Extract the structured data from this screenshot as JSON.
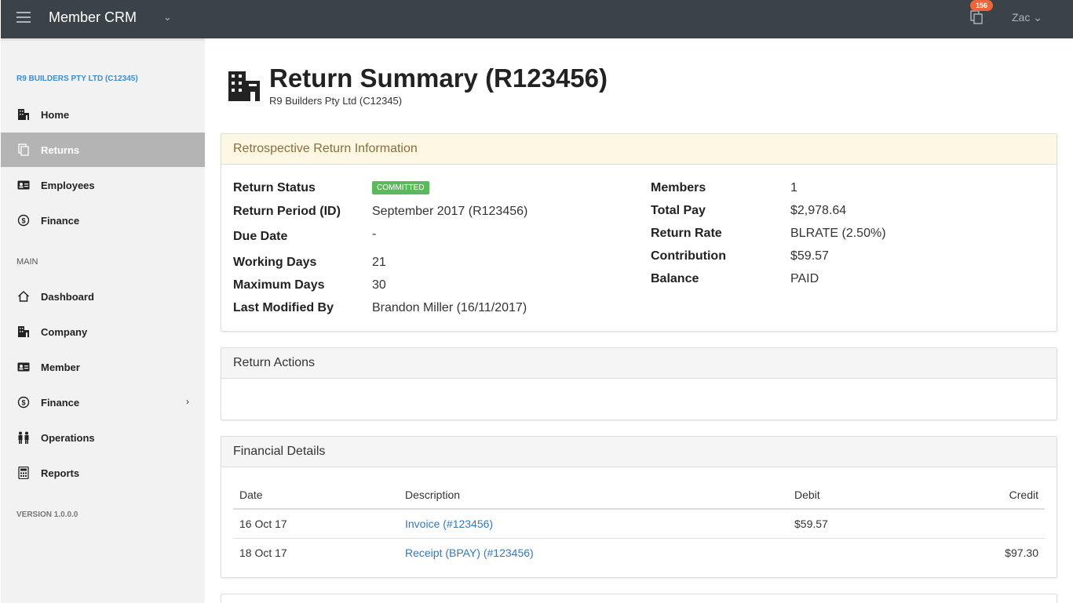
{
  "topbar": {
    "app_title": "Member CRM",
    "notification_count": "156",
    "user_name": "Zac"
  },
  "sidebar": {
    "company": "R9 BUILDERS PTY LTD (C12345)",
    "items": [
      {
        "label": "Home",
        "icon": "building-icon"
      },
      {
        "label": "Returns",
        "icon": "copy-icon",
        "active": true
      },
      {
        "label": "Employees",
        "icon": "id-card-icon"
      },
      {
        "label": "Finance",
        "icon": "dollar-circle-icon"
      }
    ],
    "main_section": "MAIN",
    "main_items": [
      {
        "label": "Dashboard",
        "icon": "home-icon"
      },
      {
        "label": "Company",
        "icon": "building-icon"
      },
      {
        "label": "Member",
        "icon": "id-card-icon"
      },
      {
        "label": "Finance",
        "icon": "dollar-circle-icon",
        "has_submenu": true
      },
      {
        "label": "Operations",
        "icon": "people-icon"
      },
      {
        "label": "Reports",
        "icon": "calculator-icon"
      }
    ],
    "version": "VERSION 1.0.0.0"
  },
  "page": {
    "title": "Return Summary (R123456)",
    "subtitle": "R9 Builders Pty Ltd (C12345)"
  },
  "info_panel": {
    "heading": "Retrospective Return Information",
    "left": [
      {
        "label": "Return Status",
        "value": "COMMITTED",
        "badge": true
      },
      {
        "label": "Return Period (ID)",
        "value": "September 2017 (R123456)"
      },
      {
        "label": "Due Date",
        "value": "-"
      },
      {
        "label": "Working Days",
        "value": "21"
      },
      {
        "label": "Maximum Days",
        "value": "30"
      },
      {
        "label": "Last Modified By",
        "value": "Brandon Miller (16/11/2017)"
      }
    ],
    "right": [
      {
        "label": "Members",
        "value": "1"
      },
      {
        "label": "Total Pay",
        "value": "$2,978.64"
      },
      {
        "label": "Return Rate",
        "value": "BLRATE (2.50%)"
      },
      {
        "label": "Contribution",
        "value": "$59.57"
      },
      {
        "label": "Balance",
        "value": "PAID"
      }
    ]
  },
  "actions_panel": {
    "heading": "Return Actions"
  },
  "financial_panel": {
    "heading": "Financial Details",
    "columns": [
      "Date",
      "Description",
      "Debit",
      "Credit"
    ],
    "rows": [
      {
        "date": "16 Oct 17",
        "description": "Invoice (#123456)",
        "debit": "$59.57",
        "credit": ""
      },
      {
        "date": "18 Oct 17",
        "description": "Receipt (BPAY) (#123456)",
        "debit": "",
        "credit": "$97.30"
      }
    ]
  },
  "colors": {
    "topbar": "#3b4349",
    "sidebar": "#f2f2f2",
    "active_item": "#b4b4b4",
    "badge_success": "#5cb85c",
    "notif_badge": "#f0643c",
    "link": "#337ab7"
  }
}
